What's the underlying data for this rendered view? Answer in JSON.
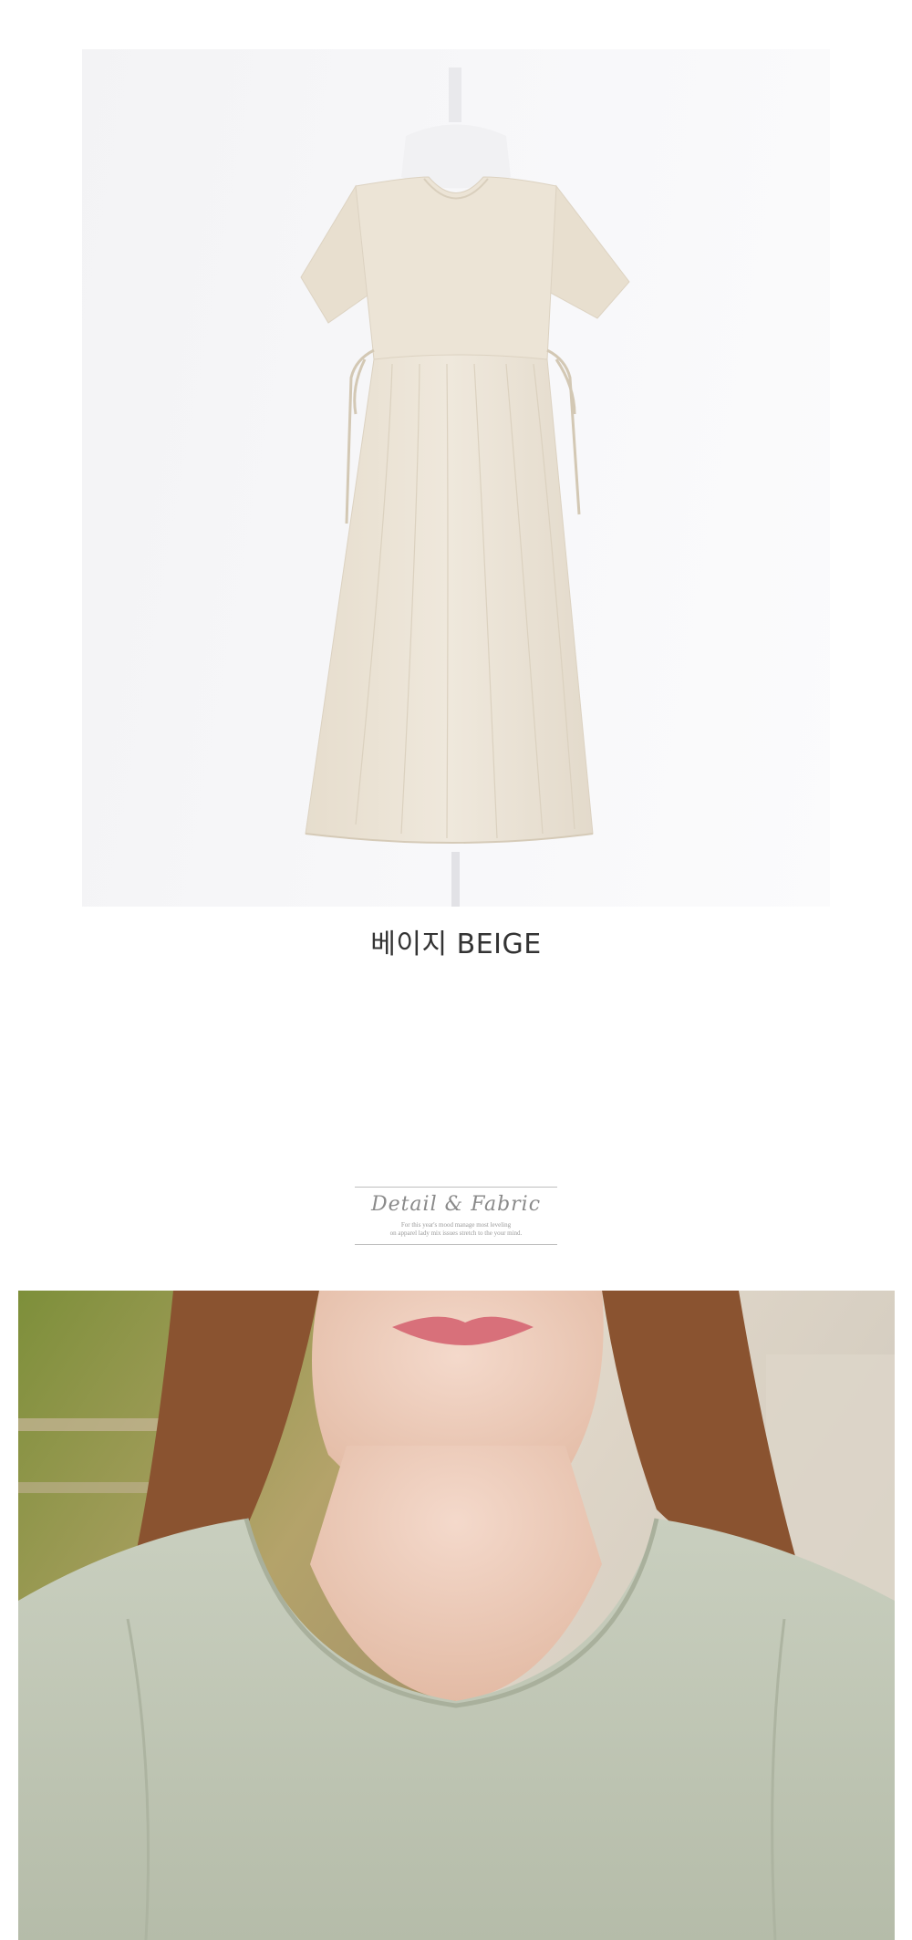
{
  "product": {
    "color_label": "베이지 BEIGE",
    "dress_color": "#ece4d6",
    "background_color": "#f5f5f7"
  },
  "detail_section": {
    "title": "Detail & Fabric",
    "subtitle_line1": "For this year's mood manage most leveling",
    "subtitle_line2": "on apparel lady mix issues stretch to the your mind.",
    "shirt_color": "#c5cbbb",
    "hair_color": "#8a5330"
  }
}
